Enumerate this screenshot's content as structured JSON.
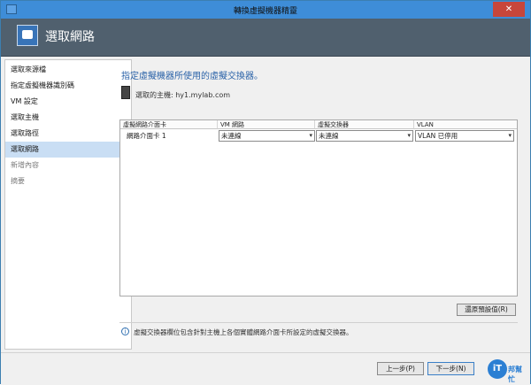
{
  "window": {
    "title": "轉換虛擬機器精靈",
    "close_label": "✕"
  },
  "header": {
    "title": "選取網路"
  },
  "sidebar": {
    "items": [
      {
        "label": "選取來源檔"
      },
      {
        "label": "指定虛擬機器識別碼"
      },
      {
        "label": "VM 設定"
      },
      {
        "label": "選取主機"
      },
      {
        "label": "選取路徑"
      },
      {
        "label": "選取網路"
      },
      {
        "label": "新增內容"
      },
      {
        "label": "摘要"
      }
    ],
    "active_index": 5
  },
  "main": {
    "heading": "指定虛擬機器所使用的虛擬交換器。",
    "host_text": "選取的主機: hy1.mylab.com"
  },
  "grid": {
    "columns": [
      "虛擬網路介面卡",
      "VM 網路",
      "虛擬交換器",
      "VLAN"
    ],
    "rows": [
      {
        "nic": "網路介面卡 1",
        "vm_network": "未連線",
        "switch": "未連線",
        "vlan": "VLAN 已停用"
      }
    ]
  },
  "reset_button": "還原預設值(R)",
  "info_text": "虛擬交換器欄位包含針對主機上各個實體網路介面卡所設定的虛擬交換器。",
  "footer": {
    "prev_label": "上一步(P)",
    "next_label": "下一步(N)",
    "logo_main": "iT",
    "logo_sub": "邦幫忙"
  },
  "colors": {
    "title_bar": "#3e8dd8",
    "header_bg": "#50606e",
    "accent": "#2a62a8",
    "active_item": "#c9def4"
  }
}
